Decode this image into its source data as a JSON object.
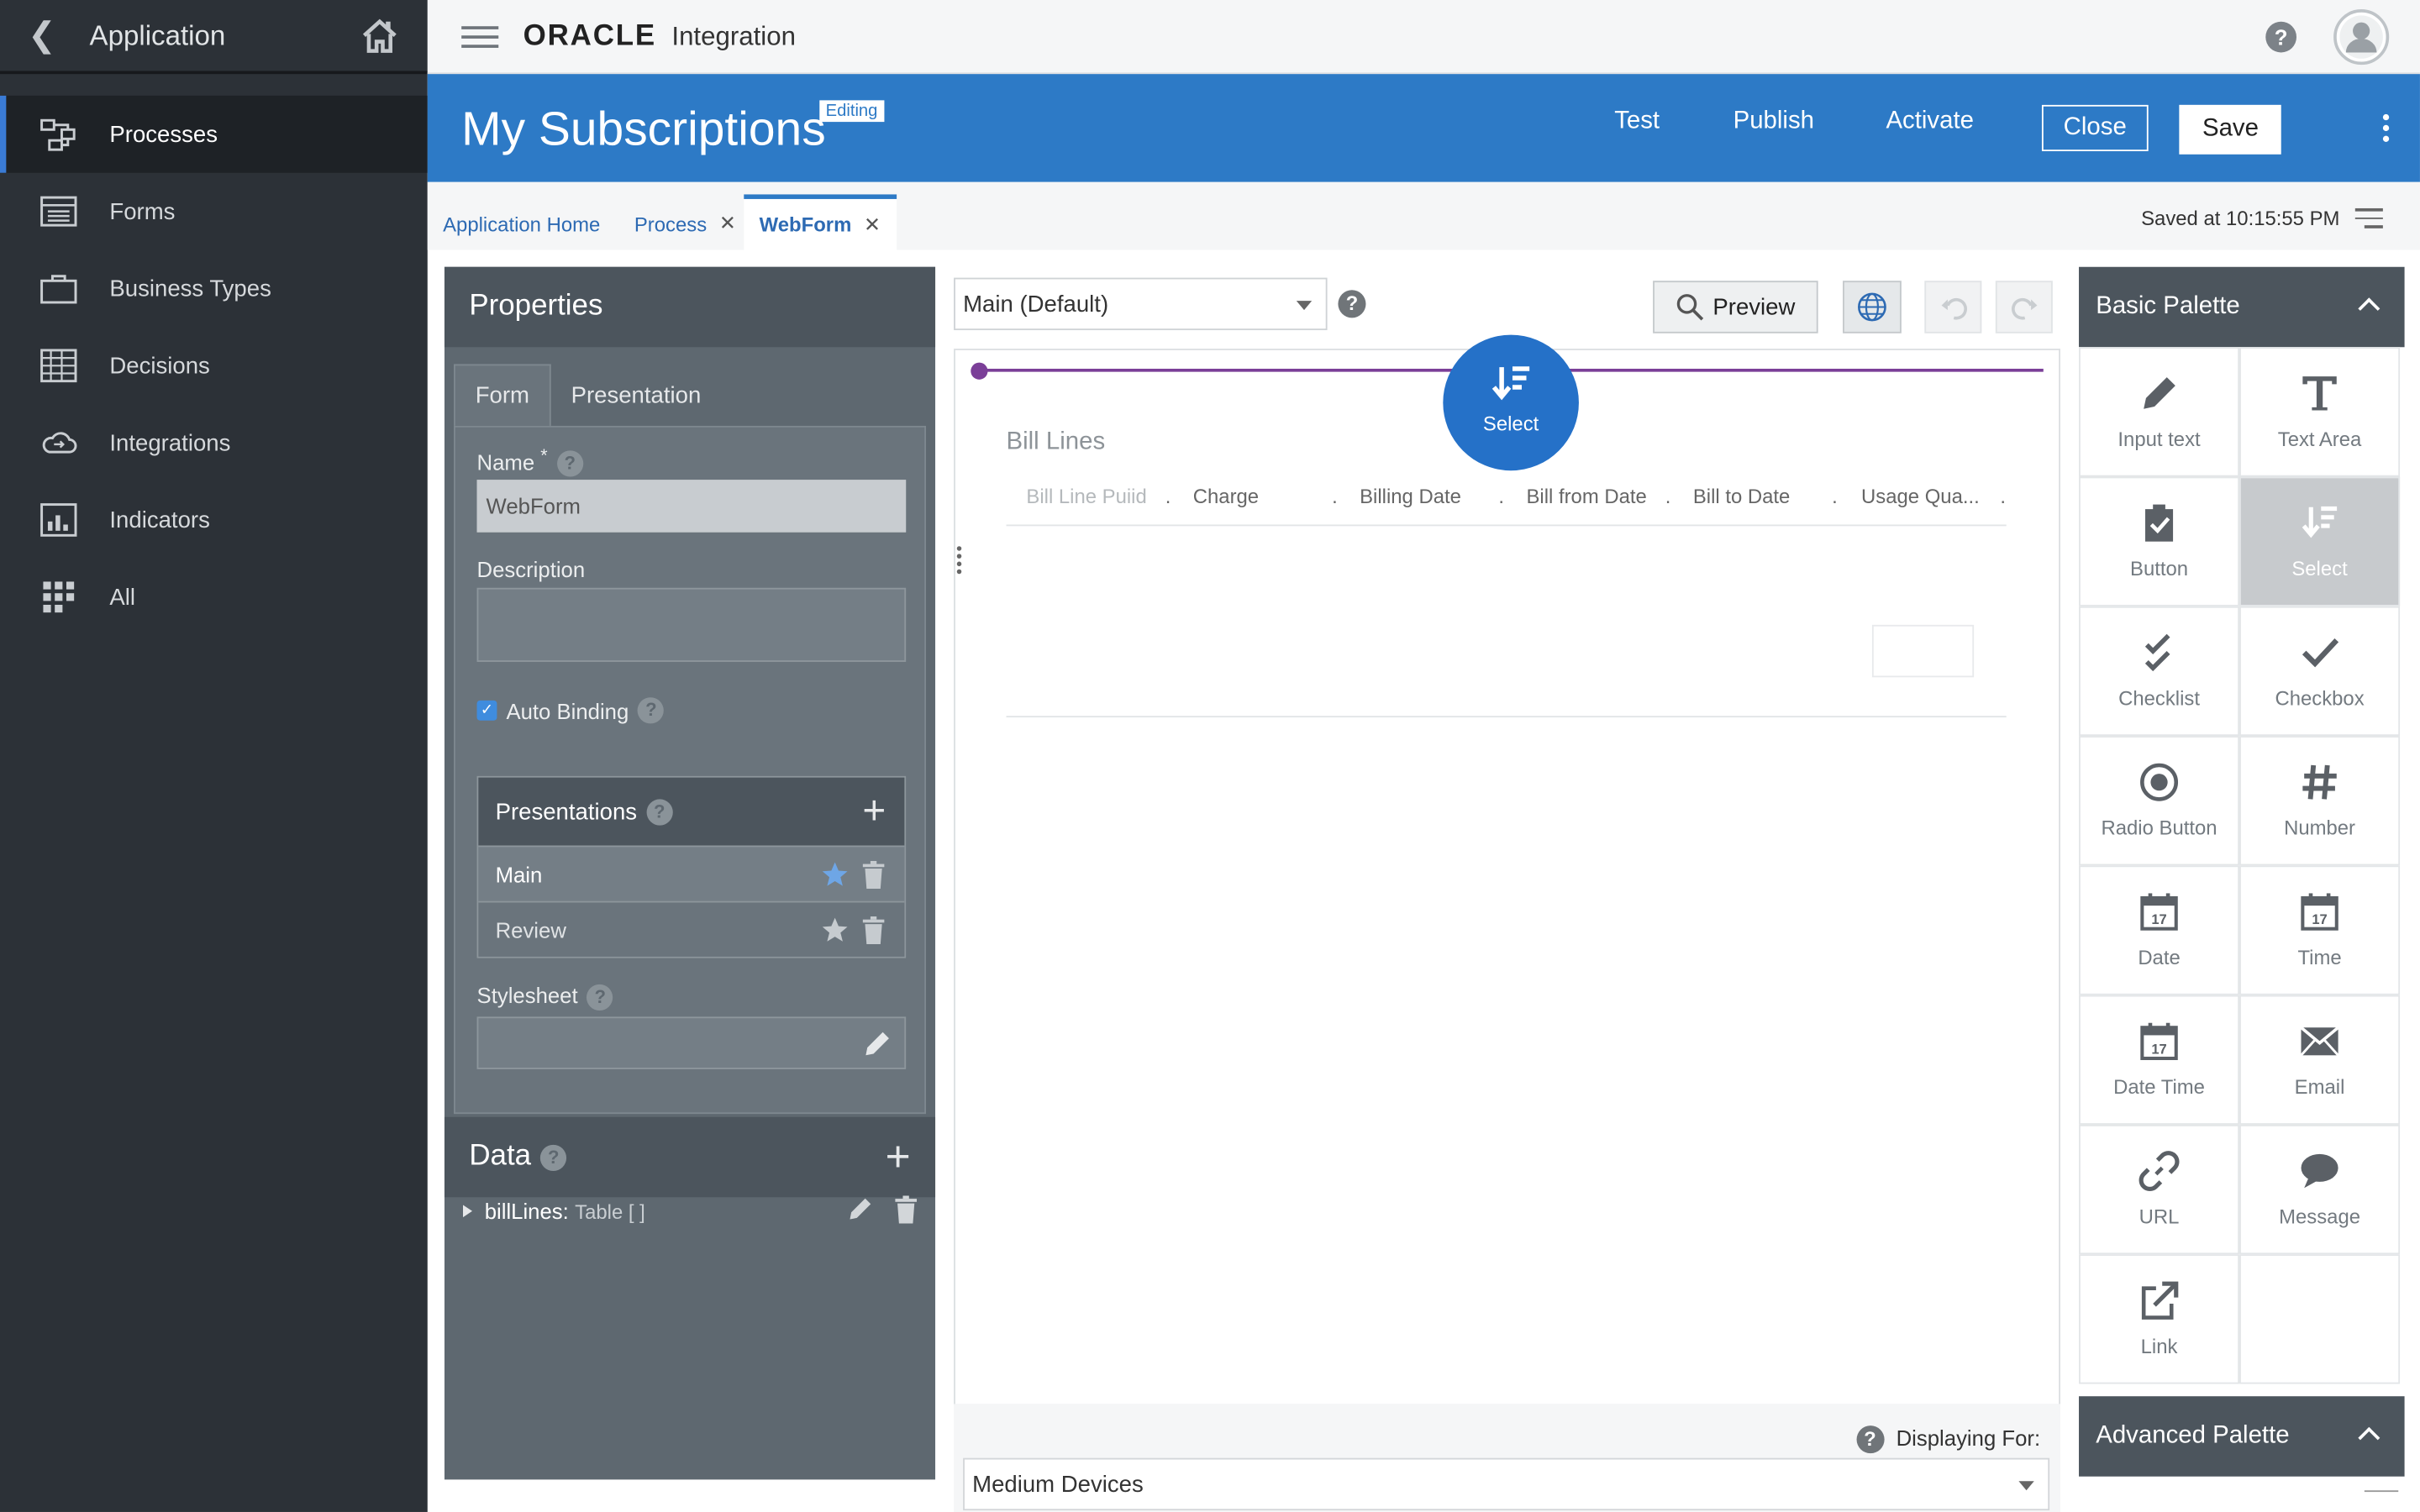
{
  "sidebar": {
    "title": "Application",
    "items": [
      {
        "label": "Processes",
        "icon": "processes-icon"
      },
      {
        "label": "Forms",
        "icon": "forms-icon"
      },
      {
        "label": "Business Types",
        "icon": "briefcase-icon"
      },
      {
        "label": "Decisions",
        "icon": "grid-table-icon"
      },
      {
        "label": "Integrations",
        "icon": "cloud-icon"
      },
      {
        "label": "Indicators",
        "icon": "chart-icon"
      },
      {
        "label": "All",
        "icon": "apps-grid-icon"
      }
    ]
  },
  "topbar": {
    "brand": "ORACLE",
    "product": "Integration",
    "help": "?"
  },
  "header": {
    "title": "My Subscriptions",
    "badge": "Editing",
    "test": "Test",
    "publish": "Publish",
    "activate": "Activate",
    "close": "Close",
    "save": "Save"
  },
  "tabs": {
    "app_home": "Application Home",
    "process": "Process",
    "webform": "WebForm",
    "close_glyph": "✕",
    "saved": "Saved at 10:15:55 PM"
  },
  "properties": {
    "title": "Properties",
    "tab_form": "Form",
    "tab_presentation": "Presentation",
    "name_label": "Name",
    "required_mark": "*",
    "name_value": "WebForm",
    "description_label": "Description",
    "description_value": "",
    "auto_binding": "Auto Binding",
    "auto_binding_checked": true,
    "presentations_title": "Presentations",
    "presentations": [
      "Main",
      "Review"
    ],
    "stylesheet_label": "Stylesheet",
    "stylesheet_value": "",
    "help": "?"
  },
  "data_panel": {
    "title": "Data",
    "item_name": "billLines:",
    "item_type": "Table [ ]"
  },
  "canvas": {
    "presentation_select": "Main (Default)",
    "preview": "Preview",
    "drag_label": "Select",
    "table_title": "Bill Lines",
    "columns": [
      "Bill Line Puiid",
      "Charge",
      "Billing Date",
      "Bill from Date",
      "Bill to Date",
      "Usage Qua..."
    ],
    "col_sep": ".",
    "displaying_for": "Displaying For:",
    "device": "Medium Devices"
  },
  "palette": {
    "basic_title": "Basic Palette",
    "advanced_title": "Advanced Palette",
    "items": [
      "Input text",
      "Text Area",
      "Button",
      "Select",
      "Checklist",
      "Checkbox",
      "Radio Button",
      "Number",
      "Date",
      "Time",
      "Date Time",
      "Email",
      "URL",
      "Message",
      "Link"
    ],
    "selected": "Select",
    "calendar_day": "17"
  },
  "colors": {
    "brand_blue": "#2d7ac6",
    "sidebar_bg": "#2c3137",
    "accent_purple": "#7b3f98"
  }
}
